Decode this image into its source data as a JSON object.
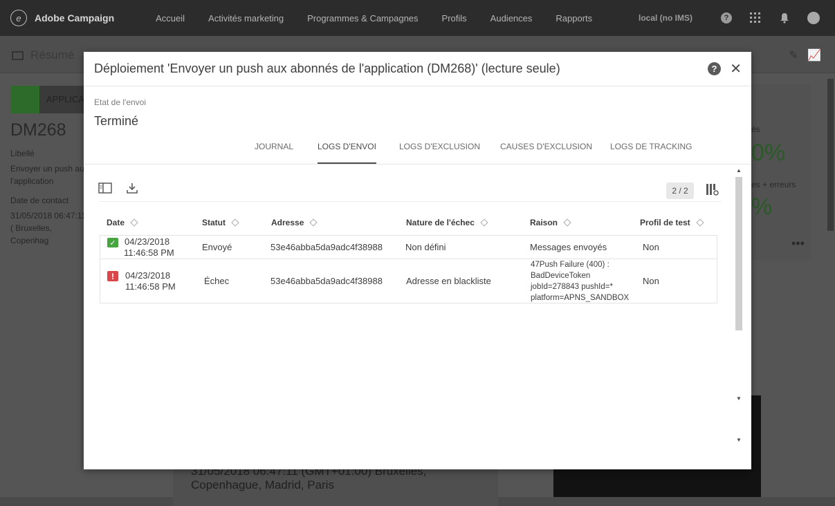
{
  "topnav": {
    "brand": "Adobe Campaign",
    "items": [
      "Accueil",
      "Activités marketing",
      "Programmes & Campagnes",
      "Profils",
      "Audiences",
      "Rapports"
    ],
    "user": "local (no IMS)",
    "icons": [
      "help-icon",
      "apps-grid-icon",
      "bell-icon",
      "avatar"
    ]
  },
  "background": {
    "resume": "Résumé",
    "applic": "APPLICAT",
    "dm": "DM268",
    "libelle_label": "Libellé",
    "libelle_value": "Envoyer un push au l'application",
    "contact_label": "Date de contact",
    "contact_value": "31/05/2018 06:47:11 ( Bruxelles, Copenhag",
    "bottom_text": "31/05/2018 06:47:11 (GMT+01:00) Bruxelles, Copenhague, Madrid, Paris",
    "pct1": "0%",
    "pct2": "%",
    "label_errors": "es + erreurs",
    "label_s": "és"
  },
  "modal": {
    "title": "Déploiement 'Envoyer un push aux abonnés de l'application (DM268)' (lecture seule)",
    "status_label": "Etat de l'envoi",
    "status_value": "Terminé",
    "tabs": [
      "Journal",
      "Logs d'envoi",
      "Logs d'exclusion",
      "Causes d'exclusion",
      "Logs de tracking"
    ],
    "active_tab": 1,
    "pager": "2 / 2",
    "columns": [
      "Date",
      "Statut",
      "Adresse",
      "Nature de l'échec",
      "Raison",
      "Profil de test"
    ],
    "rows": [
      {
        "status_icon": "success",
        "date1": "04/23/2018",
        "date2": "11:46:58 PM",
        "statut": "Envoyé",
        "adresse": "53e46abba5da9adc4f38988",
        "nature": "Non défini",
        "raison": "Messages envoyés",
        "profil": "Non"
      },
      {
        "status_icon": "error",
        "date1": "04/23/2018",
        "date2": "11:46:58 PM",
        "statut": "Échec",
        "adresse": "53e46abba5da9adc4f38988",
        "nature": "Adresse en blackliste",
        "raison": "47Push Failure (400) : BadDeviceToken jobId=278843 pushId=* platform=APNS_SANDBOX",
        "profil": "Non"
      }
    ]
  }
}
